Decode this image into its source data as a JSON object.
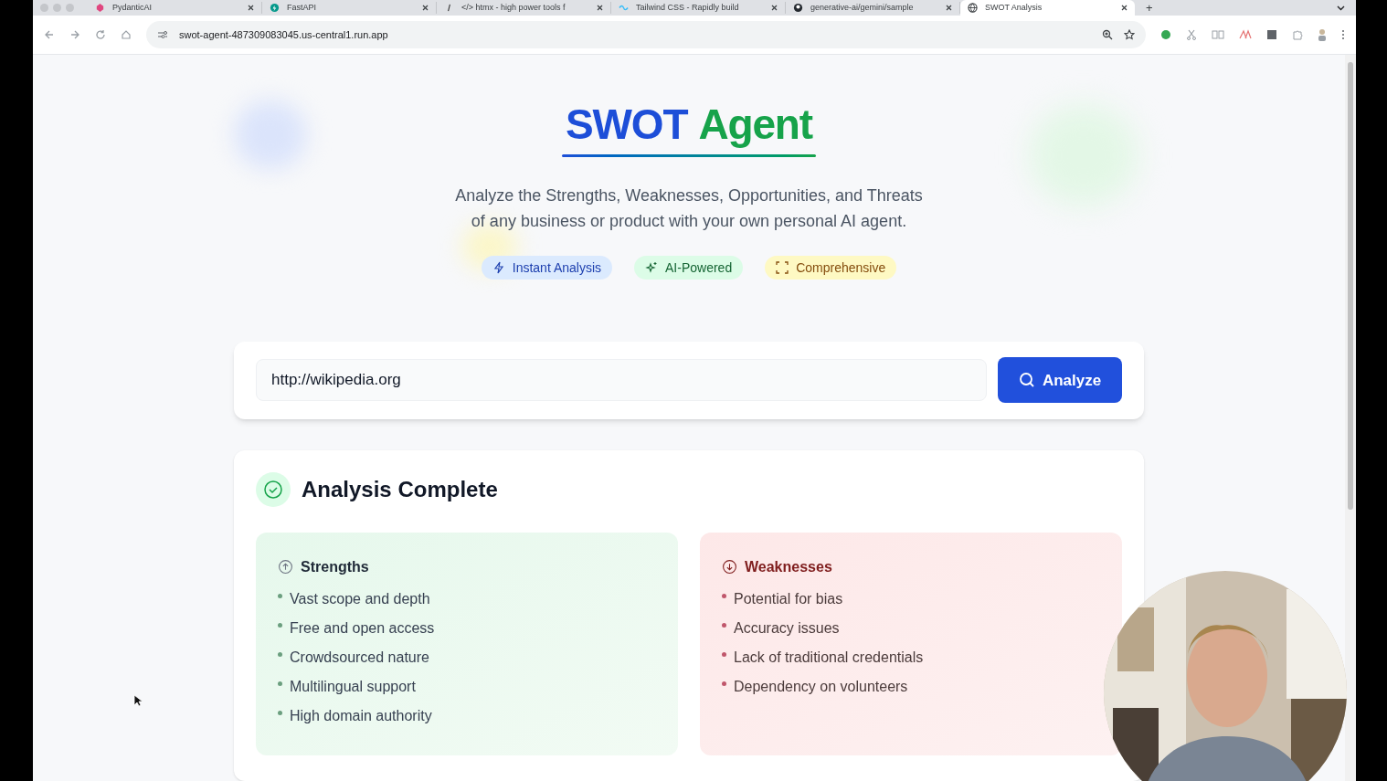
{
  "browser": {
    "tabs": [
      {
        "title": "PydanticAI",
        "selected": false
      },
      {
        "title": "FastAPI",
        "selected": false
      },
      {
        "title": "</> htmx - high power tools f",
        "selected": false
      },
      {
        "title": "Tailwind CSS - Rapidly build",
        "selected": false
      },
      {
        "title": "generative-ai/gemini/sample",
        "selected": false
      },
      {
        "title": "SWOT Analysis",
        "selected": true
      }
    ],
    "new_tab": "+",
    "url": "swot-agent-487309083045.us-central1.run.app"
  },
  "hero": {
    "title_words": [
      {
        "text": "SWOT",
        "color": "#1d4ed8"
      },
      {
        "text": "Agent",
        "color": "#16a34a"
      }
    ],
    "subtitle": "Analyze the Strengths, Weaknesses, Opportunities, and Threats of any business or product with your own personal AI agent.",
    "badges": [
      {
        "kind": "bolt",
        "label": "Instant Analysis",
        "color": "#dbeafe"
      },
      {
        "kind": "sparkle",
        "label": "AI-Powered",
        "color": "#dcfce7"
      },
      {
        "kind": "expand",
        "label": "Comprehensive",
        "color": "#fef9c3"
      }
    ]
  },
  "search": {
    "value": "http://wikipedia.org",
    "button": "Analyze"
  },
  "result": {
    "heading": "Analysis Complete",
    "sections": [
      {
        "kind": "strengths",
        "title": "Strengths",
        "items": [
          "Vast scope and depth",
          "Free and open access",
          "Crowdsourced nature",
          "Multilingual support",
          "High domain authority"
        ]
      },
      {
        "kind": "weaknesses",
        "title": "Weaknesses",
        "items": [
          "Potential for bias",
          "Accuracy issues",
          "Lack of traditional credentials",
          "Dependency on volunteers"
        ]
      }
    ]
  }
}
